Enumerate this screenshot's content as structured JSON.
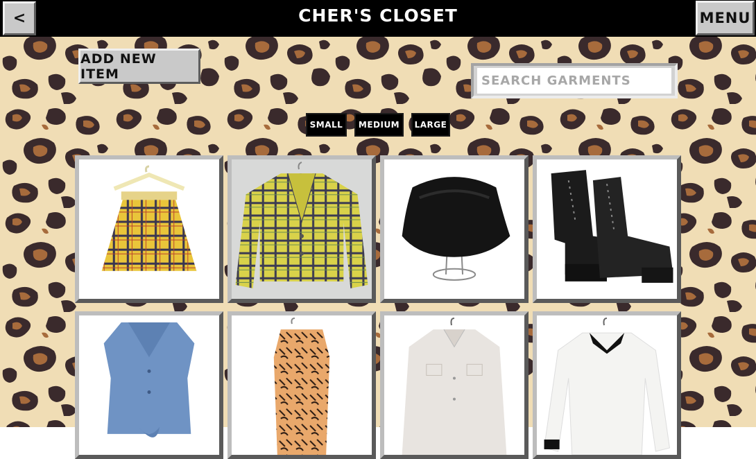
{
  "header": {
    "title": "CHER'S CLOSET",
    "back_label": "<",
    "menu_label": "MENU",
    "back_icon": "chevron-left-icon"
  },
  "toolbar": {
    "add_label": "ADD NEW ITEM",
    "search_placeholder": "SEARCH GARMENTS",
    "search_value": ""
  },
  "size_filters": [
    "SMALL",
    "MEDIUM",
    "LARGE"
  ],
  "background": {
    "pattern": "leopard print",
    "colors": {
      "base": "#f0ddb5",
      "spot_dark": "#3a2a2c",
      "spot_brown": "#a76b3c"
    }
  },
  "garments": [
    {
      "name": "yellow plaid pleated skirt on hanger"
    },
    {
      "name": "yellow plaid blazer"
    },
    {
      "name": "black velvet bucket hat on stand"
    },
    {
      "name": "black lace-up platform boots"
    },
    {
      "name": "denim sleeveless tie-front top"
    },
    {
      "name": "orange print sleeveless bodysuit"
    },
    {
      "name": "white long-sleeve button shirt"
    },
    {
      "name": "white shirt with black collar and cuffs"
    }
  ]
}
